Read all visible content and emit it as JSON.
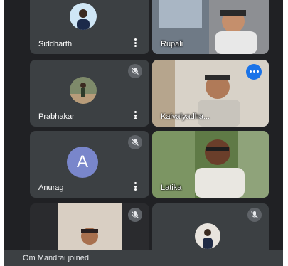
{
  "participants": [
    {
      "name": "Siddharth"
    },
    {
      "name": "Rupali"
    },
    {
      "name": "Prabhakar"
    },
    {
      "name": "Kaivalyadha..."
    },
    {
      "name": "Anurag",
      "initial": "A"
    },
    {
      "name": "Latika"
    },
    {
      "name": ""
    },
    {
      "name": ""
    }
  ],
  "notification": {
    "text": "Om Mandrai joined"
  },
  "icons": {
    "mute": "mic-off-icon",
    "more": "more-vert-icon",
    "speaking": "speaking-indicator-icon"
  },
  "colors": {
    "background": "#202124",
    "tile": "#3c4043",
    "mute_badge": "#5f6368",
    "speaking_badge": "#1a73e8",
    "letter_avatar": "#7986cb"
  }
}
